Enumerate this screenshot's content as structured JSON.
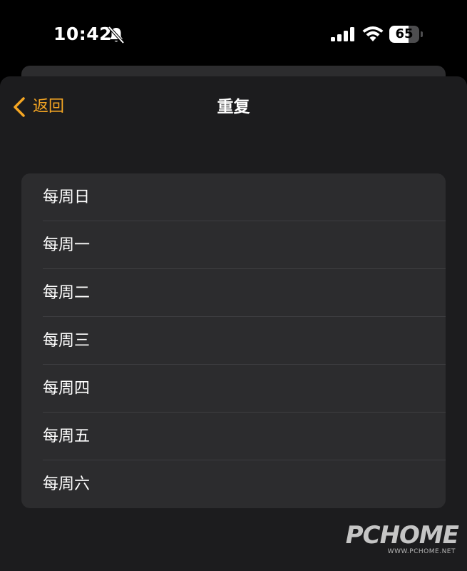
{
  "status_bar": {
    "time": "10:42",
    "battery_level": "65",
    "battery_fraction": 0.65,
    "icons": [
      "bell-slash-icon",
      "signal-icon",
      "wifi-icon",
      "battery-icon"
    ]
  },
  "nav": {
    "back_label": "返回",
    "back_icon": "chevron-left-icon",
    "title": "重复"
  },
  "repeat_options": [
    {
      "label": "每周日"
    },
    {
      "label": "每周一"
    },
    {
      "label": "每周二"
    },
    {
      "label": "每周三"
    },
    {
      "label": "每周四"
    },
    {
      "label": "每周五"
    },
    {
      "label": "每周六"
    }
  ],
  "watermark": {
    "main": "PCHOME",
    "sub": "WWW.PCHOME.NET"
  },
  "colors": {
    "accent": "#f5a623",
    "background": "#000000",
    "sheet": "#1c1c1e",
    "card": "#2c2c2e",
    "divider": "#3d3d40"
  }
}
